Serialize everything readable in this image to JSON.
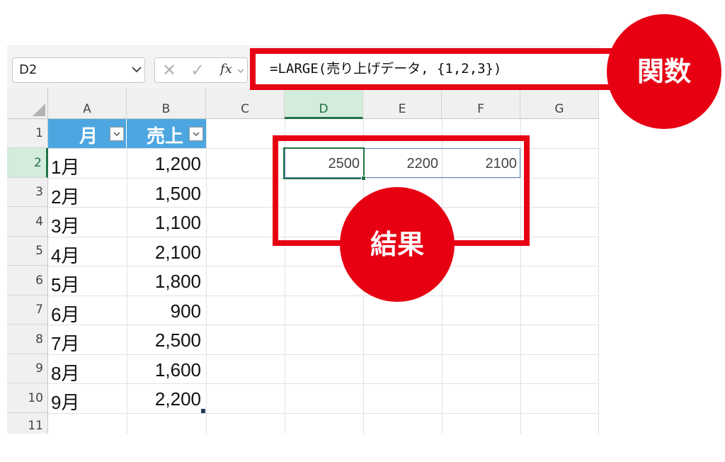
{
  "name_box": {
    "value": "D2"
  },
  "formula_bar": {
    "cancel_symbol": "✕",
    "enter_symbol": "✓",
    "fx_label": "fx",
    "formula": "=LARGE(売り上げデータ, {1,2,3})"
  },
  "columns": [
    "A",
    "B",
    "C",
    "D",
    "E",
    "F",
    "G"
  ],
  "selected_column": "D",
  "rows": [
    "1",
    "2",
    "3",
    "4",
    "5",
    "6",
    "7",
    "8",
    "9",
    "10",
    "11"
  ],
  "selected_row": "2",
  "table": {
    "headers": [
      "月",
      "売上"
    ],
    "header_color": "#4da6e0",
    "data": [
      {
        "month": "1月",
        "sales": "1,200"
      },
      {
        "month": "2月",
        "sales": "1,500"
      },
      {
        "month": "3月",
        "sales": "1,100"
      },
      {
        "month": "4月",
        "sales": "2,100"
      },
      {
        "month": "5月",
        "sales": "1,800"
      },
      {
        "month": "6月",
        "sales": "900"
      },
      {
        "month": "7月",
        "sales": "2,500"
      },
      {
        "month": "8月",
        "sales": "1,600"
      },
      {
        "month": "9月",
        "sales": "2,200"
      }
    ]
  },
  "results": [
    "2500",
    "2200",
    "2100"
  ],
  "annotations": {
    "function_label": "関数",
    "result_label": "結果",
    "accent_color": "#e60012"
  }
}
